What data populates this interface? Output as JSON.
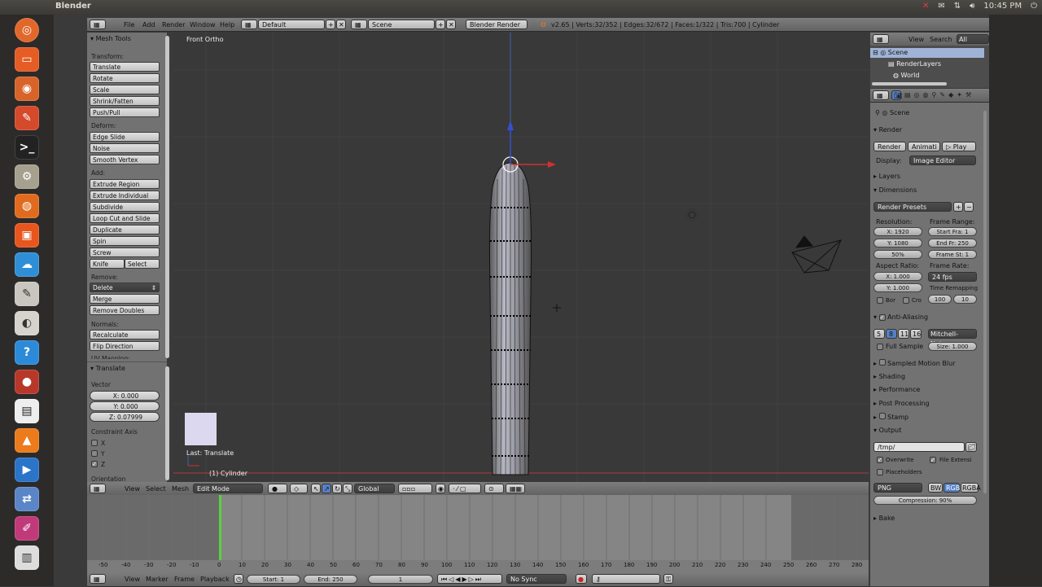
{
  "app_title": "Blender",
  "system_tray": {
    "time": "10:45 PM"
  },
  "info_header": {
    "menus": [
      "File",
      "Add",
      "Render",
      "Window",
      "Help"
    ],
    "layout": "Default",
    "scene": "Scene",
    "engine": "Blender Render",
    "stats": "v2.65 | Verts:32/352 | Edges:32/672 | Faces:1/322 | Tris:700 | Cylinder"
  },
  "toolshelf": {
    "title": "Mesh Tools",
    "transform_label": "Transform:",
    "transform": [
      "Translate",
      "Rotate",
      "Scale",
      "Shrink/Fatten",
      "Push/Pull"
    ],
    "deform_label": "Deform:",
    "deform": [
      "Edge Slide",
      "Noise",
      "Smooth Vertex"
    ],
    "add_label": "Add:",
    "add": [
      "Extrude Region",
      "Extrude Individual",
      "Subdivide",
      "Loop Cut and Slide",
      "Duplicate",
      "Spin",
      "Screw"
    ],
    "knife": "Knife",
    "select": "Select",
    "remove_label": "Remove:",
    "delete": "Delete",
    "merge": "Merge",
    "remove_doubles": "Remove Doubles",
    "normals_label": "Normals:",
    "recalculate": "Recalculate",
    "flip_direction": "Flip Direction",
    "uv_mapping": "UV Mapping:"
  },
  "operator_panel": {
    "title": "Translate",
    "vector_label": "Vector",
    "x": "X: 0.000",
    "y": "Y: 0.000",
    "z": "Z: 0.07999",
    "constraint_label": "Constraint Axis",
    "axes": [
      "X",
      "Y",
      "Z"
    ],
    "orientation_label": "Orientation"
  },
  "viewport": {
    "view_name": "Front Ortho",
    "last_op": "Last: Translate",
    "object_name": "(1) Cylinder"
  },
  "viewport_header": {
    "menus": [
      "View",
      "Select",
      "Mesh"
    ],
    "mode": "Edit Mode",
    "orientation": "Global"
  },
  "outliner": {
    "menus": [
      "View",
      "Search"
    ],
    "filter": "All Scenes",
    "items": [
      "Scene",
      "RenderLayers",
      "World"
    ]
  },
  "properties": {
    "context": "Scene",
    "render_title": "Render",
    "render_buttons": [
      "Render",
      "Animati",
      "Play"
    ],
    "display_label": "Display:",
    "display_value": "Image Editor",
    "layers": "Layers",
    "dimensions": "Dimensions",
    "render_presets": "Render Presets",
    "resolution_label": "Resolution:",
    "res_x": "X: 1920",
    "res_y": "Y: 1080",
    "res_pct": "50%",
    "frame_range_label": "Frame Range:",
    "start_frame": "Start Fra: 1",
    "end_frame": "End Fr: 250",
    "frame_step": "Frame St: 1",
    "aspect_label": "Aspect Ratio:",
    "aspect_x": "X: 1.000",
    "aspect_y": "Y: 1.000",
    "frame_rate_label": "Frame Rate:",
    "fps": "24 fps",
    "time_remap_label": "Time Remapping",
    "bor": "Bor",
    "cro": "Cro",
    "remap_old": "100",
    "remap_new": "10",
    "anti_aliasing": "Anti-Aliasing",
    "aa_samples": [
      "5",
      "8",
      "11",
      "16"
    ],
    "aa_filter": "Mitchell-Netra",
    "full_sample": "Full Sample",
    "aa_size": "Size: 1.000",
    "sampled_motion_blur": "Sampled Motion Blur",
    "shading": "Shading",
    "performance": "Performance",
    "post_processing": "Post Processing",
    "stamp": "Stamp",
    "output": "Output",
    "output_path": "/tmp/",
    "overwrite": "Overwrite",
    "file_extensions": "File Extensi",
    "placeholders": "Placeholders",
    "file_format": "PNG",
    "color_modes": [
      "BW",
      "RGB",
      "RGBA"
    ],
    "compression": "Compression: 90%",
    "bake": "Bake"
  },
  "timeline": {
    "ruler": [
      "-50",
      "-40",
      "-30",
      "-20",
      "-10",
      "0",
      "10",
      "20",
      "30",
      "40",
      "50",
      "60",
      "70",
      "80",
      "90",
      "100",
      "110",
      "120",
      "130",
      "140",
      "150",
      "160",
      "170",
      "180",
      "190",
      "200",
      "210",
      "220",
      "230",
      "240",
      "250",
      "260",
      "270",
      "280"
    ],
    "menus": [
      "View",
      "Marker",
      "Frame",
      "Playback"
    ],
    "start": "Start: 1",
    "end": "End: 250",
    "current": "1",
    "sync": "No Sync"
  }
}
